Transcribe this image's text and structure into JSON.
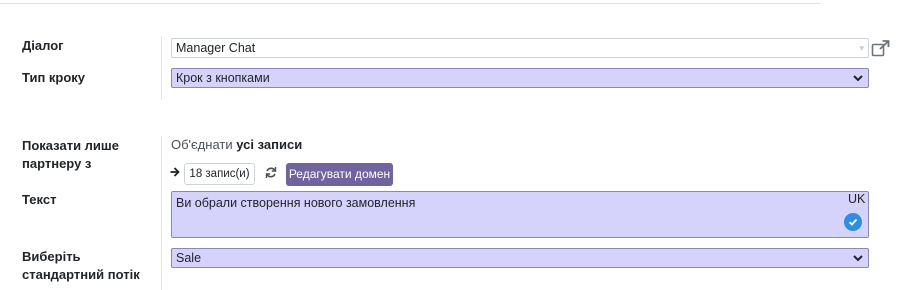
{
  "form": {
    "dialog_label": "Діалог",
    "dialog_value": "Manager Chat",
    "step_type_label": "Тип кроку",
    "step_type_value": "Крок з кнопками",
    "partner_label_line1": "Показати лише",
    "partner_label_line2": "партнеру з",
    "domain_prefix": "Об'єднати",
    "domain_bold": "усі записи",
    "records_count": "18 запис(и)",
    "edit_domain_button": "Редагувати домен",
    "text_label": "Текст",
    "text_value": "Ви обрали створення нового замовлення",
    "lang_badge": "UK",
    "flow_label_line1": "Виберіть",
    "flow_label_line2": "стандартний потік",
    "flow_value": "Sale"
  },
  "colors": {
    "required_field_bg": "#d5d3fb",
    "primary_button": "#71639e",
    "translate_check": "#2f8ee0"
  },
  "icons": {
    "external": "external-link-icon",
    "arrow": "arrow-right-icon",
    "refresh": "refresh-icon",
    "check": "check-circle-icon",
    "dropdown": "chevron-down-icon"
  }
}
